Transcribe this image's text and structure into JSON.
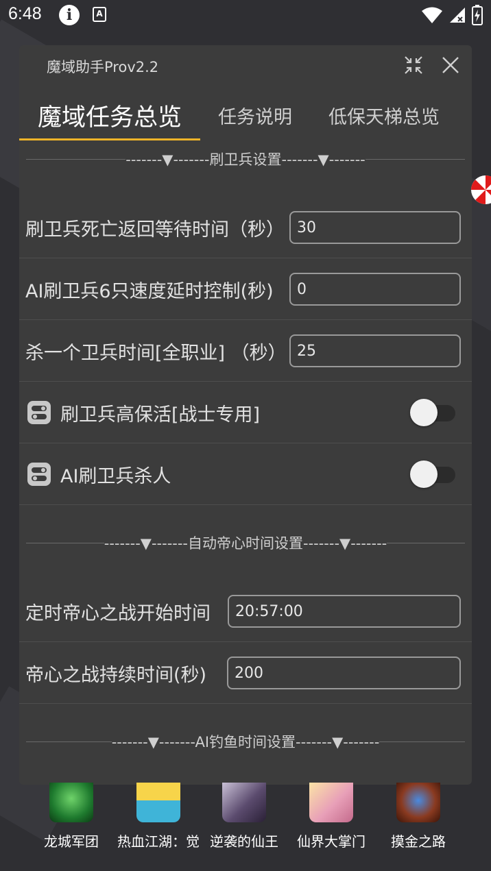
{
  "status_bar": {
    "time": "6:48"
  },
  "panel": {
    "title": "魔域助手Prov2.2",
    "tabs": [
      {
        "label": "魔域任务总览",
        "active": true
      },
      {
        "label": "任务说明",
        "active": false
      },
      {
        "label": "低保天梯总览",
        "active": false
      }
    ]
  },
  "sections": {
    "guard": "-------▼-------刷卫兵设置-------▼-------",
    "emperor": "-------▼-------自动帝心时间设置-------▼-------",
    "fishing": "-------▼-------AI钓鱼时间设置-------▼-------"
  },
  "fields": {
    "death_wait": {
      "label": "刷卫兵死亡返回等待时间（秒）",
      "value": "30"
    },
    "ai_speed": {
      "label": "AI刷卫兵6只速度延时控制(秒)",
      "value": "0"
    },
    "kill_time": {
      "label": "杀一个卫兵时间[全职业]  （秒）",
      "value": "25"
    },
    "emperor_start": {
      "label": "定时帝心之战开始时间",
      "value": "20:57:00"
    },
    "emperor_duration": {
      "label": "帝心之战持续时间(秒)",
      "value": "200"
    }
  },
  "toggles": {
    "high_survival": {
      "label": "刷卫兵高保活[战士专用]",
      "on": false
    },
    "ai_kill": {
      "label": "AI刷卫兵杀人",
      "on": false
    }
  },
  "games": [
    {
      "name": "龙城军团",
      "color": "#1e7a2e"
    },
    {
      "name": "热血江湖：觉",
      "color": "#3fb4d8"
    },
    {
      "name": "逆袭的仙王",
      "color": "#5b4b6e"
    },
    {
      "name": "仙界大掌门",
      "color": "#e8a0b8"
    },
    {
      "name": "摸金之路",
      "color": "#8a3a20"
    }
  ],
  "colors": {
    "accent": "#f0b429",
    "panel": "#3c3c3c",
    "background": "#2f2f33"
  }
}
